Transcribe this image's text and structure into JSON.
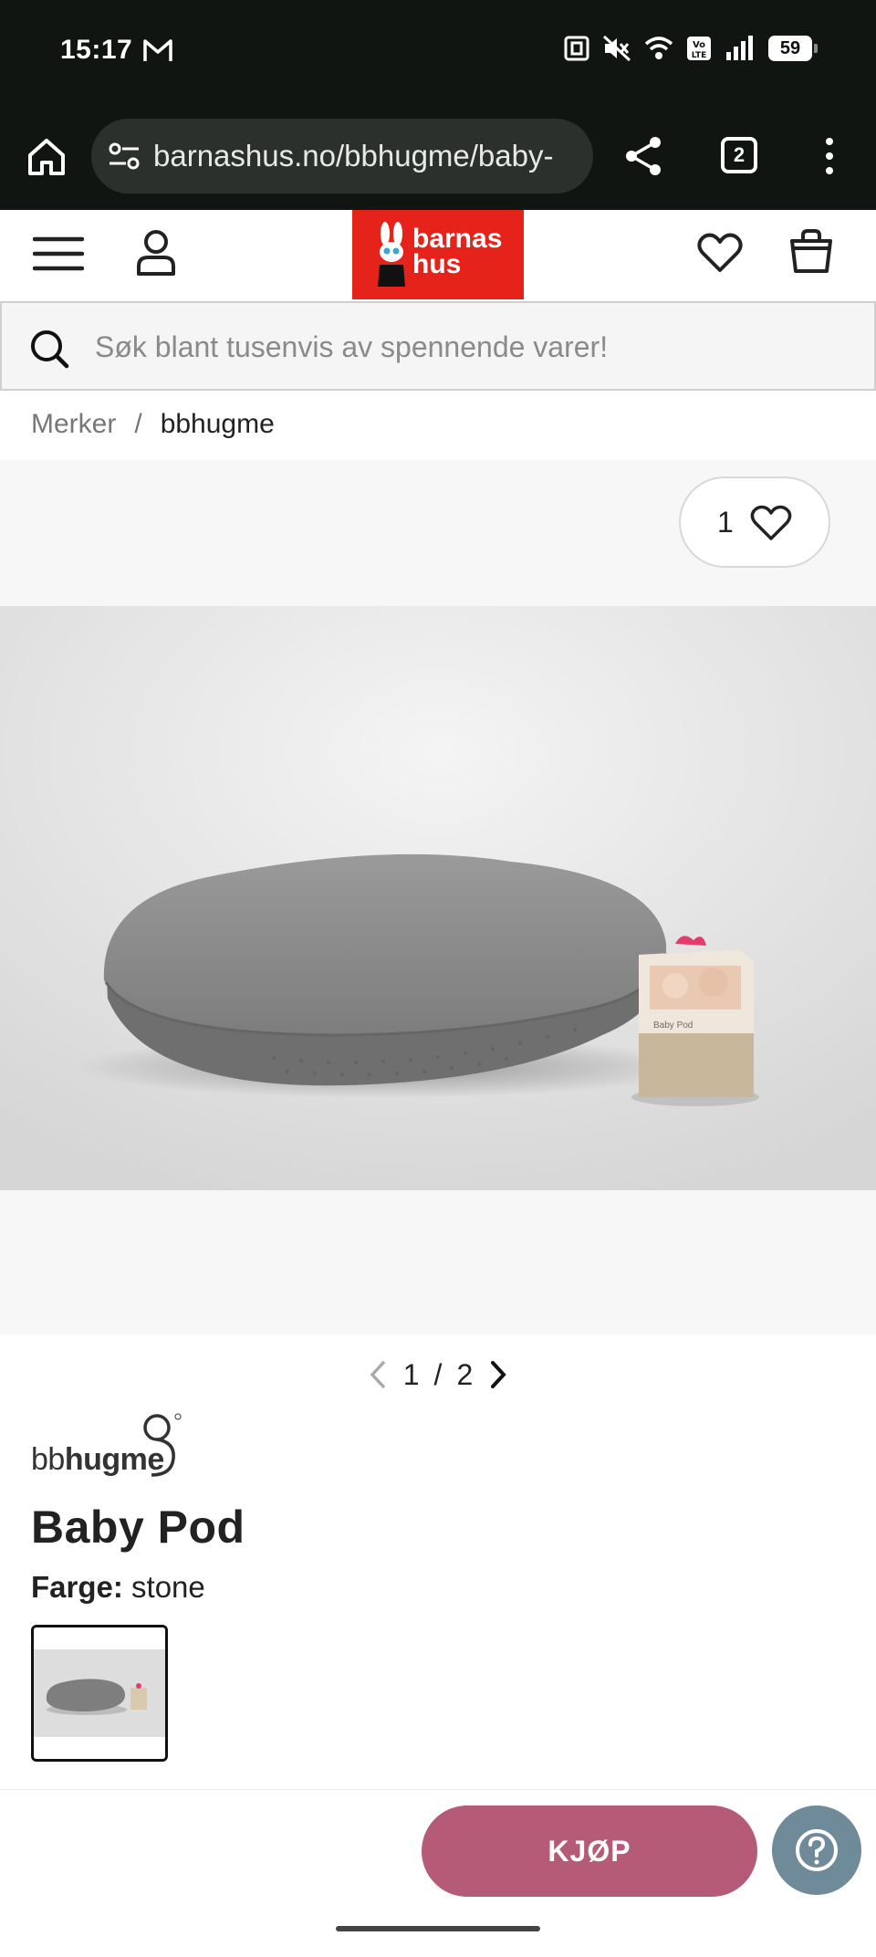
{
  "status_bar": {
    "time": "15:17",
    "battery": "59"
  },
  "browser": {
    "url": "barnashus.no/bbhugme/baby-",
    "tab_count": "2"
  },
  "site": {
    "logo_line1": "barnas",
    "logo_line2": "hus",
    "brand_color": "#e5231b"
  },
  "search": {
    "placeholder": "Søk blant tusenvis av spennende varer!"
  },
  "breadcrumb": {
    "items": [
      "Merker",
      "bbhugme"
    ],
    "separator": "/"
  },
  "gallery": {
    "wishlist_count": "1",
    "current_page": "1",
    "page_separator": "/",
    "total_pages": "2"
  },
  "product": {
    "brand_prefix": "bb",
    "brand_name": "hugme",
    "title": "Baby Pod",
    "color_label": "Farge:",
    "color_value": "stone"
  },
  "actions": {
    "buy_label": "KJØP",
    "buy_color": "#b55a77",
    "help_color": "#6f8a99"
  },
  "icons": {
    "home": "home-icon",
    "site_settings": "tune-icon",
    "share": "share-icon",
    "menu": "more-vert-icon",
    "hamburger": "hamburger-icon",
    "user": "user-icon",
    "wishlist": "heart-icon",
    "cart": "bag-icon",
    "search": "search-icon",
    "help": "question-icon"
  }
}
